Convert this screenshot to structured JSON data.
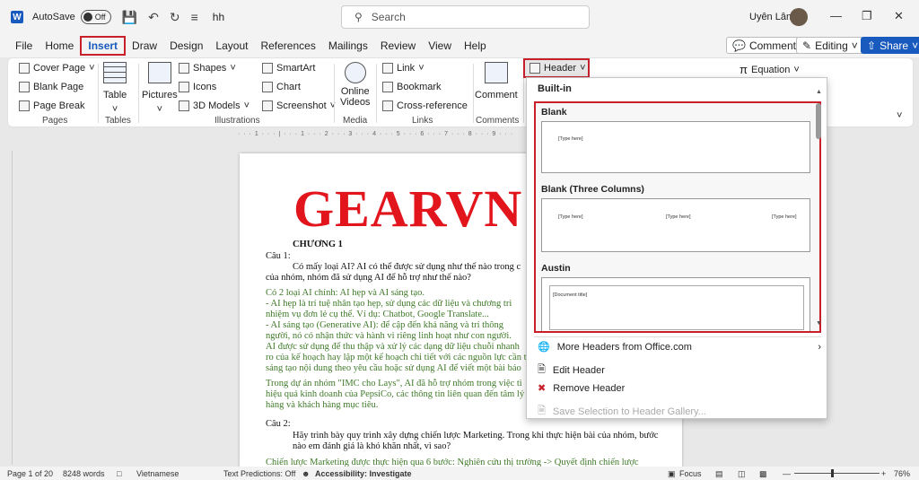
{
  "titlebar": {
    "app_icon": "W",
    "autosave_label": "AutoSave",
    "autosave_state": "Off",
    "doc_name": "hh",
    "search_placeholder": "Search",
    "user_name": "Uyên Lâm"
  },
  "menu": {
    "tabs": [
      "File",
      "Home",
      "Insert",
      "Draw",
      "Design",
      "Layout",
      "References",
      "Mailings",
      "Review",
      "View",
      "Help"
    ],
    "active": "Insert",
    "comments_label": "Comments",
    "editing_label": "Editing",
    "share_label": "Share"
  },
  "ribbon": {
    "pages": {
      "cover_page": "Cover Page",
      "blank_page": "Blank Page",
      "page_break": "Page Break",
      "label": "Pages"
    },
    "tables": {
      "table": "Table",
      "label": "Tables"
    },
    "illustrations": {
      "pictures": "Pictures",
      "shapes": "Shapes",
      "icons": "Icons",
      "models": "3D Models",
      "smartart": "SmartArt",
      "chart": "Chart",
      "screenshot": "Screenshot",
      "label": "Illustrations"
    },
    "media": {
      "online_videos_1": "Online",
      "online_videos_2": "Videos",
      "label": "Media"
    },
    "links": {
      "link": "Link",
      "bookmark": "Bookmark",
      "cross_reference": "Cross-reference",
      "label": "Links"
    },
    "comments": {
      "comment": "Comment",
      "label": "Comments"
    },
    "header": {
      "label": "Header"
    },
    "equation": "Equation"
  },
  "dropdown": {
    "section": "Built-in",
    "items": [
      {
        "name": "Blank",
        "placeholders": [
          "[Type here]"
        ]
      },
      {
        "name": "Blank (Three Columns)",
        "placeholders": [
          "[Type here]",
          "[Type here]",
          "[Type here]"
        ]
      },
      {
        "name": "Austin",
        "placeholders": [
          "[Document title]"
        ]
      }
    ],
    "more": "More Headers from Office.com",
    "edit": "Edit Header",
    "remove": "Remove Header",
    "save": "Save Selection to Header Gallery..."
  },
  "document": {
    "title": "GEARVN",
    "chapter": "CHƯƠNG 1",
    "lines": [
      {
        "text": "Câu 1:",
        "cls": ""
      },
      {
        "text": "Có mấy loại AI? AI có thể được sử dụng như thế nào trong c",
        "cls": ""
      },
      {
        "text": "của nhóm, nhóm đã sử dụng AI để hỗ trợ như thế nào?",
        "cls": ""
      },
      {
        "text": "Có 2 loại AI chính: AI hẹp và AI sáng tạo.",
        "cls": "green"
      },
      {
        "text": "-    AI hẹp là trí tuệ nhân tạo hẹp, sử dụng các dữ liệu và chương trì",
        "cls": "green"
      },
      {
        "text": "     nhiệm vụ đơn lẻ cụ thể. Ví dụ: Chatbot, Google Translate...",
        "cls": "green"
      },
      {
        "text": "-    AI sáng tạo (Generative AI): để cập đến khả năng và trí thông",
        "cls": "green"
      },
      {
        "text": "     người, nó có nhận thức và hành vi riêng linh hoạt như con người.",
        "cls": "green"
      },
      {
        "text": "AI được sử dụng để thu thập và xử lý các dạng dữ liệu chuỗi nhanh",
        "cls": "green"
      },
      {
        "text": "ro của kế hoạch hay lập một kế hoạch chi tiết với các nguồn lực cần t",
        "cls": "green"
      },
      {
        "text": "sáng tạo nội dung theo yêu cầu hoặc sử dụng AI để viết một bài báo",
        "cls": "green"
      },
      {
        "text": "Trong dự án nhóm \"IMC cho Lays\", AI đã hỗ trợ nhóm trong việc tì",
        "cls": "green"
      },
      {
        "text": "hiệu quả kinh doanh của PepsiCo, các thông tin liên quan đến tâm lý",
        "cls": "green"
      },
      {
        "text": "hàng và khách hàng mục tiêu.",
        "cls": "green"
      },
      {
        "text": "Câu 2:",
        "cls": ""
      },
      {
        "text": "Hãy trình bày quy trình xây dựng chiến lược Marketing. Trong khi thực hiện bài của nhóm, bước",
        "cls": ""
      },
      {
        "text": "nào em đánh giá là khó khăn nhất, vì sao?",
        "cls": ""
      },
      {
        "text": "Chiến lược Marketing được thực hiện qua 6 bước: Nghiên cứu thị trường -> Quyết định chiến lược",
        "cls": "green"
      }
    ]
  },
  "status": {
    "page": "Page 1 of 20",
    "words": "8248 words",
    "language": "Vietnamese",
    "predictions": "Text Predictions: Off",
    "accessibility": "Accessibility: Investigate",
    "focus": "Focus",
    "zoom": "76%"
  }
}
